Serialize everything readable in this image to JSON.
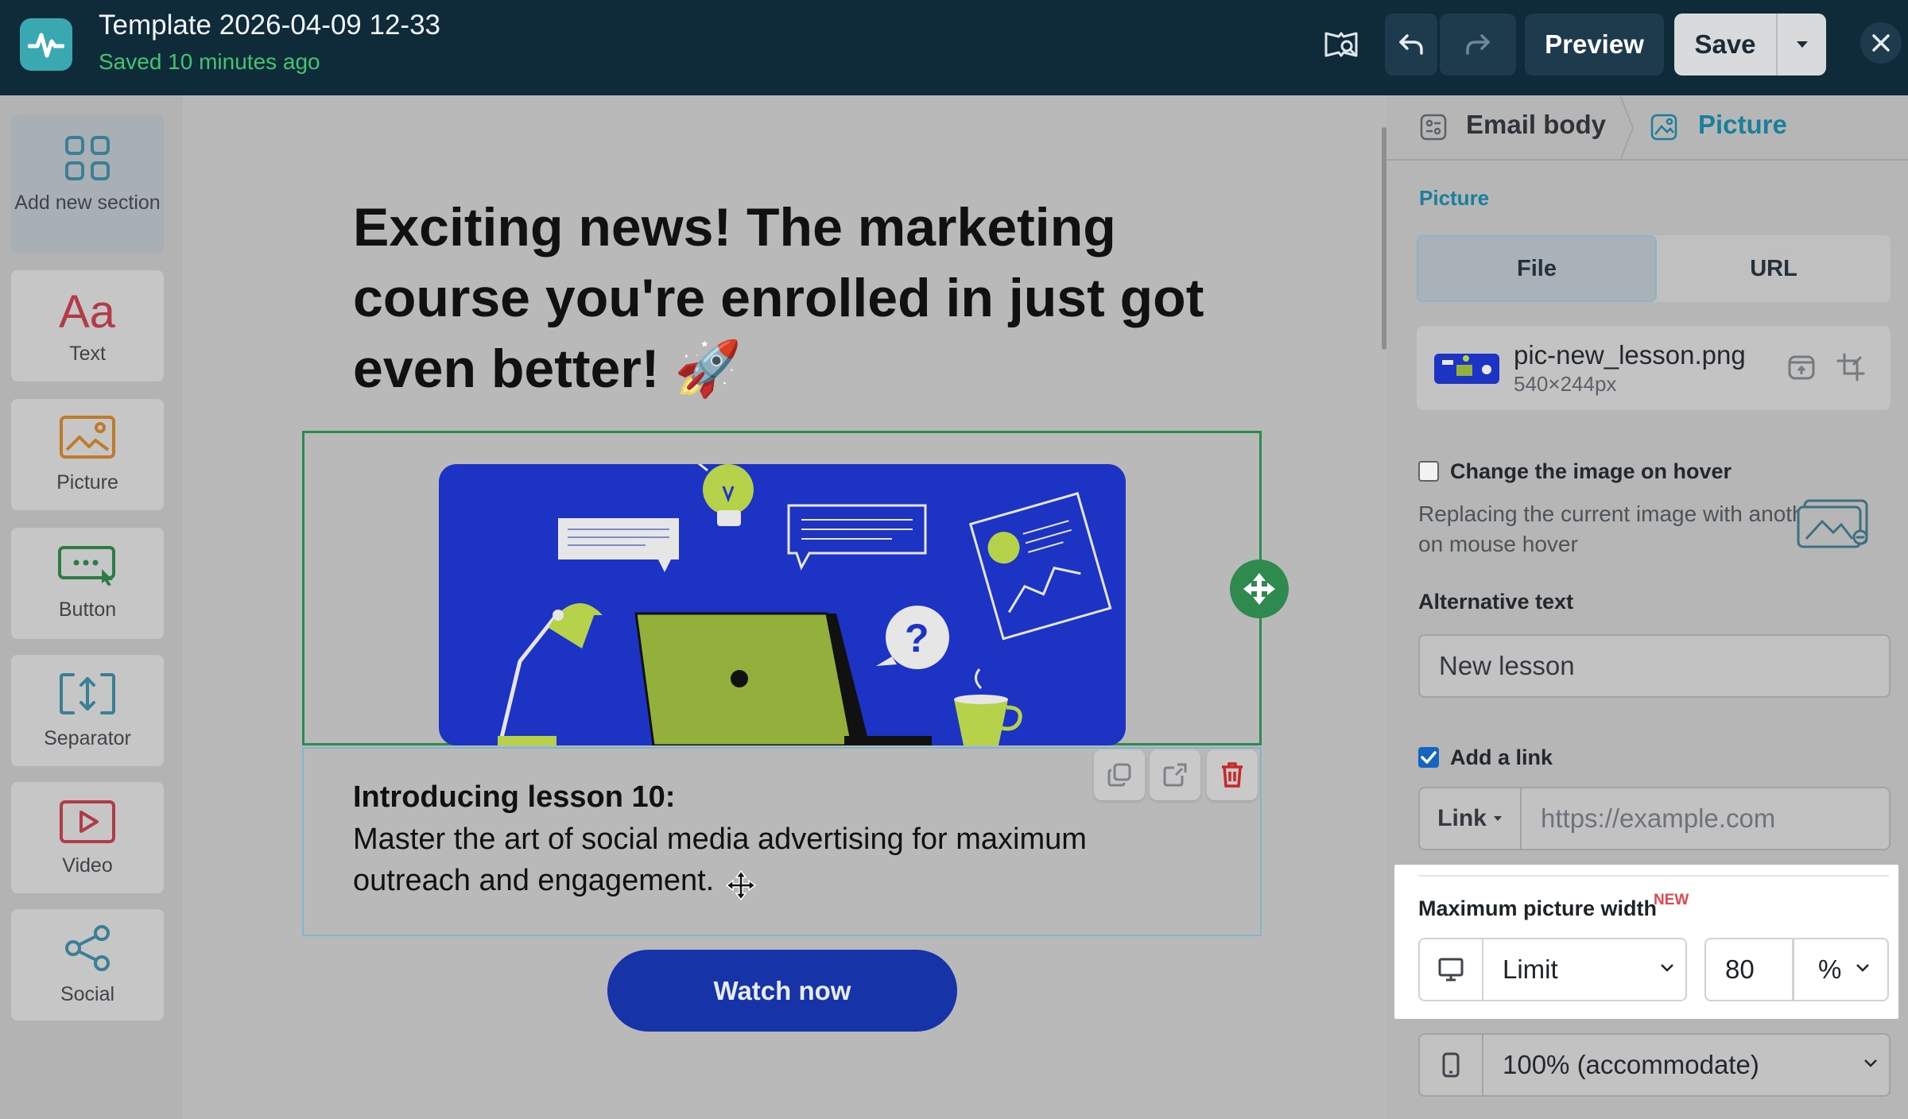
{
  "app": {
    "template_title": "Template 2026-04-09 12-33",
    "saved_status": "Saved 10 minutes ago"
  },
  "toolbar": {
    "preview_label": "Preview",
    "save_label": "Save"
  },
  "left_tools": [
    {
      "label": "Add new section",
      "icon": "grid-icon"
    },
    {
      "label": "Text",
      "icon": "text-aa-icon"
    },
    {
      "label": "Picture",
      "icon": "picture-icon"
    },
    {
      "label": "Button",
      "icon": "button-icon"
    },
    {
      "label": "Separator",
      "icon": "separator-icon"
    },
    {
      "label": "Video",
      "icon": "video-icon"
    },
    {
      "label": "Social",
      "icon": "share-icon"
    }
  ],
  "email": {
    "headline": "Exciting news! The marketing course you're enrolled in just got even better! 🚀",
    "lesson_heading": "Introducing lesson 10:",
    "lesson_body": "Master the art of social media advertising for maximum outreach and engagement.",
    "cta_label": "Watch now"
  },
  "panel": {
    "breadcrumb": {
      "root": "Email body",
      "current": "Picture"
    },
    "section_label": "Picture",
    "source_tabs": {
      "file": "File",
      "url": "URL",
      "selected": "File"
    },
    "file": {
      "name": "pic-new_lesson.png",
      "size": "540×244px"
    },
    "hover": {
      "checked": false,
      "label": "Change the image on hover",
      "description": "Replacing the current image with another on mouse hover"
    },
    "alt": {
      "label": "Alternative text",
      "value": "New lesson"
    },
    "link": {
      "checked": true,
      "label": "Add a link",
      "type_label": "Link",
      "placeholder": "https://example.com"
    },
    "max_width": {
      "label": "Maximum picture width",
      "badge": "NEW",
      "desktop_mode": "Limit",
      "desktop_value": "80",
      "unit": "%",
      "mobile_mode": "100% (accommodate)"
    }
  },
  "colors": {
    "topbar": "#0f2b3a",
    "accent_teal": "#1a7f9a",
    "saved_green": "#43c470",
    "selection_green": "#2f8a50",
    "cta_blue": "#1634a8",
    "illustration_blue": "#1c33c4",
    "illustration_lime": "#93b03d"
  }
}
